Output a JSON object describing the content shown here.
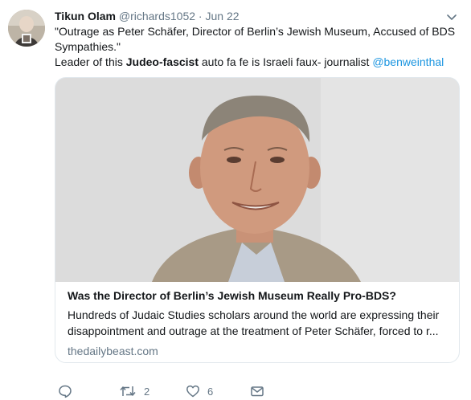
{
  "tweet": {
    "author_name": "Tikun Olam",
    "handle": "@richards1052",
    "separator": "·",
    "date": "Jun 22",
    "line1": "\"Outrage as Peter Schäfer, Director of Berlin’s Jewish Museum, Accused of BDS",
    "line2": "Sympathies.\"",
    "line3_pre": "Leader of this ",
    "line3_bold": "Judeo-fascist",
    "line3_mid": " auto fa fe is  Israeli faux- journalist ",
    "mention": "@benweinthal"
  },
  "card": {
    "title": "Was the Director of Berlin’s Jewish Museum Really Pro-BDS?",
    "desc_line1": "Hundreds of Judaic Studies scholars around the world are expressing their",
    "desc_line2": "disappointment and outrage at the treatment of Peter Schäfer, forced to r...",
    "domain": "thedailybeast.com"
  },
  "actions": {
    "reply_icon": "reply-icon",
    "retweet_icon": "retweet-icon",
    "retweet_count": "2",
    "like_icon": "heart-icon",
    "like_count": "6",
    "dm_icon": "envelope-icon"
  },
  "colors": {
    "link": "#1b95e0",
    "secondary": "#657786",
    "border": "#e1e8ed"
  }
}
